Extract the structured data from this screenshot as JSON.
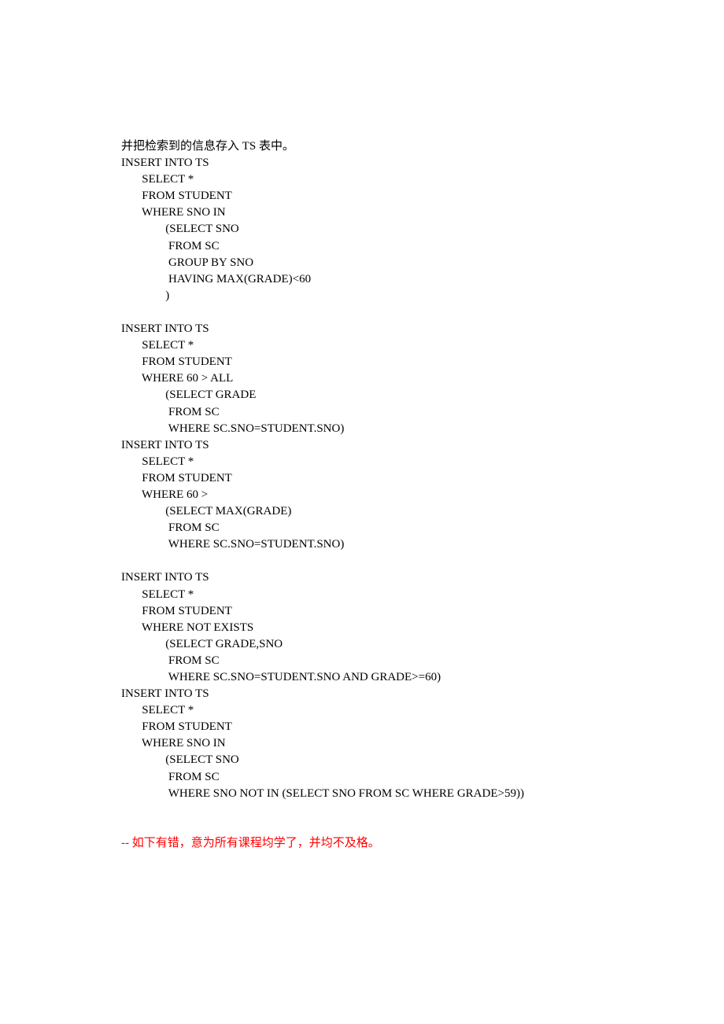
{
  "lines": [
    {
      "text": "并把检索到的信息存入 TS 表中。",
      "indent": 0,
      "cls": ""
    },
    {
      "text": "INSERT INTO TS",
      "indent": 0,
      "cls": ""
    },
    {
      "text": "SELECT *",
      "indent": 7,
      "cls": ""
    },
    {
      "text": "FROM STUDENT",
      "indent": 7,
      "cls": ""
    },
    {
      "text": "WHERE SNO IN",
      "indent": 7,
      "cls": ""
    },
    {
      "text": "(SELECT SNO",
      "indent": 15,
      "cls": ""
    },
    {
      "text": " FROM SC",
      "indent": 15,
      "cls": ""
    },
    {
      "text": " GROUP BY SNO",
      "indent": 15,
      "cls": ""
    },
    {
      "text": " HAVING MAX(GRADE)<60",
      "indent": 15,
      "cls": ""
    },
    {
      "text": ")",
      "indent": 15,
      "cls": ""
    },
    {
      "text": "",
      "indent": 0,
      "cls": "blank"
    },
    {
      "text": "INSERT INTO TS",
      "indent": 0,
      "cls": ""
    },
    {
      "text": "SELECT *",
      "indent": 7,
      "cls": ""
    },
    {
      "text": "FROM STUDENT",
      "indent": 7,
      "cls": ""
    },
    {
      "text": "WHERE 60 > ALL",
      "indent": 7,
      "cls": ""
    },
    {
      "text": "(SELECT GRADE",
      "indent": 15,
      "cls": ""
    },
    {
      "text": " FROM SC",
      "indent": 15,
      "cls": ""
    },
    {
      "text": " WHERE SC.SNO=STUDENT.SNO)",
      "indent": 15,
      "cls": ""
    },
    {
      "text": "INSERT INTO TS",
      "indent": 0,
      "cls": ""
    },
    {
      "text": "SELECT *",
      "indent": 7,
      "cls": ""
    },
    {
      "text": "FROM STUDENT",
      "indent": 7,
      "cls": ""
    },
    {
      "text": "WHERE 60 >",
      "indent": 7,
      "cls": ""
    },
    {
      "text": "(SELECT MAX(GRADE)",
      "indent": 15,
      "cls": ""
    },
    {
      "text": " FROM SC",
      "indent": 15,
      "cls": ""
    },
    {
      "text": " WHERE SC.SNO=STUDENT.SNO)",
      "indent": 15,
      "cls": ""
    },
    {
      "text": "",
      "indent": 0,
      "cls": "blank"
    },
    {
      "text": "INSERT INTO TS",
      "indent": 0,
      "cls": ""
    },
    {
      "text": "SELECT *",
      "indent": 7,
      "cls": ""
    },
    {
      "text": "FROM STUDENT",
      "indent": 7,
      "cls": ""
    },
    {
      "text": "WHERE NOT EXISTS",
      "indent": 7,
      "cls": ""
    },
    {
      "text": "(SELECT GRADE,SNO",
      "indent": 15,
      "cls": ""
    },
    {
      "text": " FROM SC",
      "indent": 15,
      "cls": ""
    },
    {
      "text": " WHERE SC.SNO=STUDENT.SNO AND GRADE>=60)",
      "indent": 15,
      "cls": ""
    },
    {
      "text": "INSERT INTO TS",
      "indent": 0,
      "cls": ""
    },
    {
      "text": "SELECT *",
      "indent": 7,
      "cls": ""
    },
    {
      "text": "FROM STUDENT",
      "indent": 7,
      "cls": ""
    },
    {
      "text": "WHERE SNO IN",
      "indent": 7,
      "cls": ""
    },
    {
      "text": "(SELECT SNO",
      "indent": 15,
      "cls": ""
    },
    {
      "text": " FROM SC",
      "indent": 15,
      "cls": ""
    },
    {
      "text": " WHERE SNO NOT IN (SELECT SNO FROM SC WHERE GRADE>59))",
      "indent": 15,
      "cls": ""
    },
    {
      "text": "",
      "indent": 0,
      "cls": "blank"
    },
    {
      "text": "",
      "indent": 0,
      "cls": "blank"
    },
    {
      "text": "-- 如下有错，意为所有课程均学了，并均不及格。",
      "indent": 0,
      "cls": "red"
    }
  ]
}
